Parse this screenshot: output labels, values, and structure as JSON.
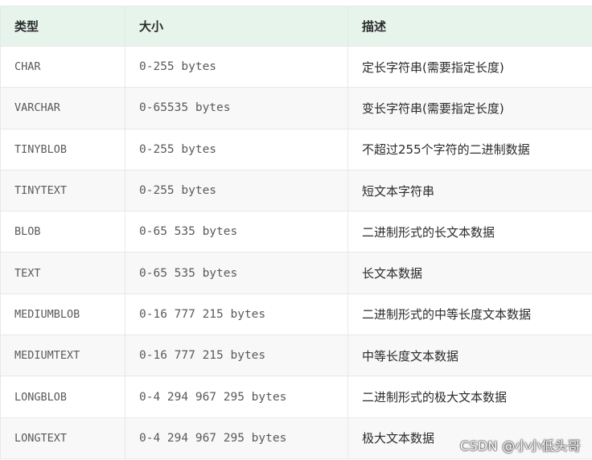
{
  "table": {
    "headers": {
      "type": "类型",
      "size": "大小",
      "desc": "描述"
    },
    "rows": [
      {
        "type": "CHAR",
        "size": "0-255 bytes",
        "desc": "定长字符串(需要指定长度)"
      },
      {
        "type": "VARCHAR",
        "size": "0-65535 bytes",
        "desc": "变长字符串(需要指定长度)"
      },
      {
        "type": "TINYBLOB",
        "size": "0-255 bytes",
        "desc": "不超过255个字符的二进制数据"
      },
      {
        "type": "TINYTEXT",
        "size": "0-255 bytes",
        "desc": "短文本字符串"
      },
      {
        "type": "BLOB",
        "size": "0-65 535 bytes",
        "desc": "二进制形式的长文本数据"
      },
      {
        "type": "TEXT",
        "size": "0-65 535 bytes",
        "desc": "长文本数据"
      },
      {
        "type": "MEDIUMBLOB",
        "size": "0-16 777 215 bytes",
        "desc": "二进制形式的中等长度文本数据"
      },
      {
        "type": "MEDIUMTEXT",
        "size": "0-16 777 215 bytes",
        "desc": "中等长度文本数据"
      },
      {
        "type": "LONGBLOB",
        "size": "0-4 294 967 295 bytes",
        "desc": "二进制形式的极大文本数据"
      },
      {
        "type": "LONGTEXT",
        "size": "0-4 294 967 295 bytes",
        "desc": "极大文本数据"
      }
    ]
  },
  "watermark": "CSDN @小小低头哥"
}
